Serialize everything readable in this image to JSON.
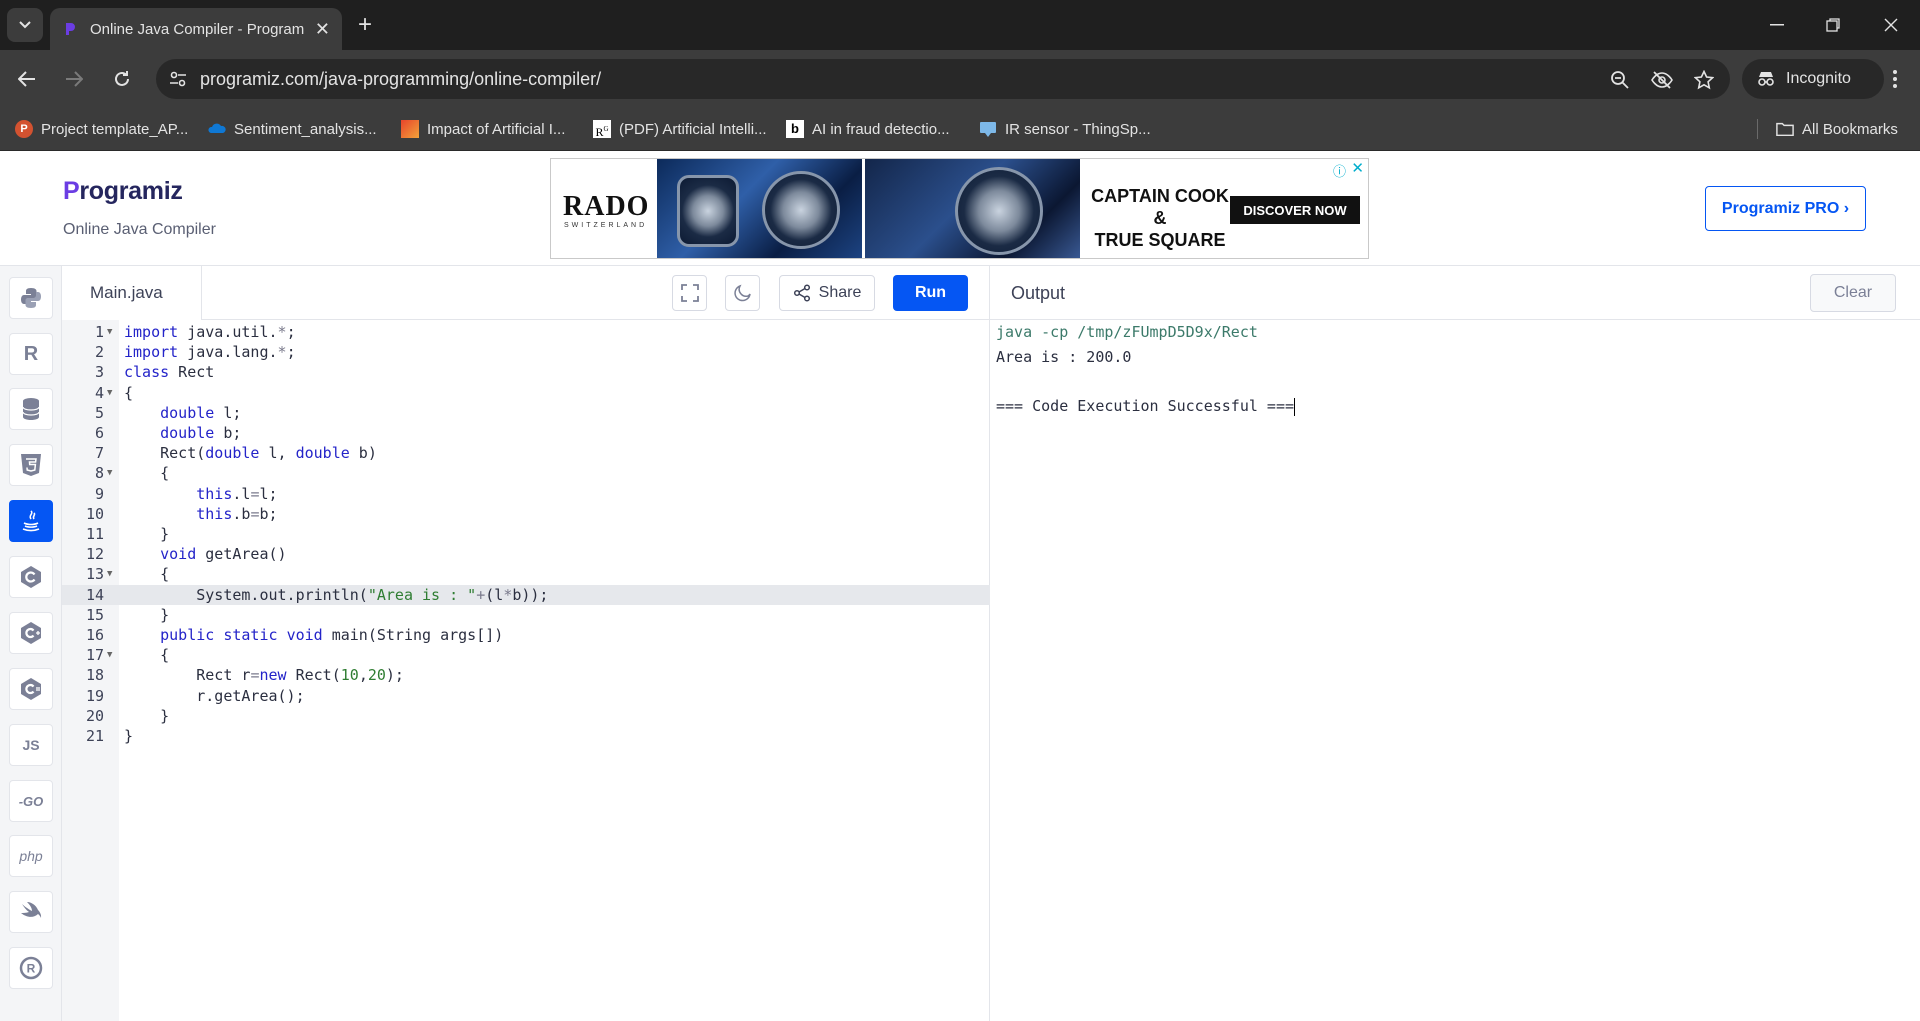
{
  "browser": {
    "tab_title": "Online Java Compiler - Programiz",
    "url": "programiz.com/java-programming/online-compiler/",
    "incognito_label": "Incognito",
    "all_bookmarks_label": "All Bookmarks",
    "bookmarks": [
      {
        "label": "Project template_AP...",
        "icon": "powerpoint-icon",
        "color": "#d35230"
      },
      {
        "label": "Sentiment_analysis...",
        "icon": "onedrive-icon",
        "color": "#0f78d4"
      },
      {
        "label": "Impact of Artificial I...",
        "icon": "doc-icon",
        "color": "#e8442b"
      },
      {
        "label": "(PDF) Artificial Intelli...",
        "icon": "researchgate-icon",
        "color": "#ffffff"
      },
      {
        "label": "AI in fraud detectio...",
        "icon": "b-icon",
        "color": "#ffffff"
      },
      {
        "label": "IR sensor - ThingSp...",
        "icon": "thingspeak-icon",
        "color": "#7db8e8"
      }
    ]
  },
  "site": {
    "logo_text": "rogramiz",
    "subtitle": "Online Java Compiler",
    "pro_button": "Programiz PRO ›",
    "ad": {
      "brand": "RADO",
      "brand_sub": "SWITZERLAND",
      "caption_line1": "CAPTAIN COOK &",
      "caption_line2": "TRUE SQUARE",
      "cta": "DISCOVER NOW"
    }
  },
  "languages": [
    "python",
    "r",
    "sql",
    "html",
    "java",
    "c",
    "cpp",
    "csharp",
    "js",
    "go",
    "php",
    "swift",
    "rust"
  ],
  "editor": {
    "file_tab": "Main.java",
    "share_label": "Share",
    "run_label": "Run",
    "active_line": 14,
    "lines": [
      "import java.util.*;",
      "import java.lang.*;",
      "class Rect",
      "{",
      "    double l;",
      "    double b;",
      "    Rect(double l, double b)",
      "    {",
      "        this.l=l;",
      "        this.b=b;",
      "    }",
      "    void getArea()",
      "    {",
      "        System.out.println(\"Area is : \"+(l*b));",
      "    }",
      "    public static void main(String args[])",
      "    {",
      "        Rect r=new Rect(10,20);",
      "        r.getArea();",
      "    }",
      "}"
    ],
    "fold_lines": [
      1,
      4,
      8,
      13,
      17
    ]
  },
  "output": {
    "title": "Output",
    "clear_label": "Clear",
    "command": "java -cp /tmp/zFUmpD5D9x/Rect",
    "result": "Area is : 200.0",
    "status": "=== Code Execution Successful ==="
  },
  "colors": {
    "accent": "#0556f3",
    "logo_purple": "#6b3de3"
  }
}
